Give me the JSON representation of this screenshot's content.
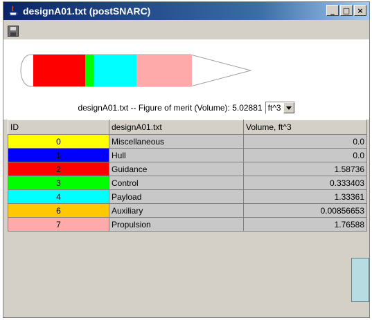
{
  "window": {
    "title": "designA01.txt (postSNARC)",
    "icon": "java-icon",
    "buttons": {
      "minimize": "_",
      "maximize": "□",
      "close": "×"
    }
  },
  "toolbar": {
    "save_icon": "save-icon"
  },
  "figure": {
    "segments": [
      {
        "name": "Guidance",
        "color": "#ff0000"
      },
      {
        "name": "Control",
        "color": "#00ff00"
      },
      {
        "name": "Payload",
        "color": "#00ffff"
      },
      {
        "name": "Propulsion",
        "color": "#ffaaaa"
      }
    ],
    "figure_of_merit_label": "designA01.txt -- Figure of merit (Volume): 5.02881",
    "unit": "ft^3"
  },
  "table": {
    "headers": [
      "ID",
      "designA01.txt",
      "Volume, ft^3"
    ],
    "rows": [
      {
        "id": "0",
        "color": "#ffff00",
        "name": "Miscellaneous",
        "volume": "0.0"
      },
      {
        "id": "1",
        "color": "#0000ff",
        "name": "Hull",
        "volume": "0.0"
      },
      {
        "id": "2",
        "color": "#ff0000",
        "name": "Guidance",
        "volume": "1.58736"
      },
      {
        "id": "3",
        "color": "#00ff00",
        "name": "Control",
        "volume": "0.333403"
      },
      {
        "id": "4",
        "color": "#00ffff",
        "name": "Payload",
        "volume": "1.33361"
      },
      {
        "id": "6",
        "color": "#ffc800",
        "name": "Auxiliary",
        "volume": "0.00856653"
      },
      {
        "id": "7",
        "color": "#ffaaaa",
        "name": "Propulsion",
        "volume": "1.76588"
      }
    ]
  }
}
